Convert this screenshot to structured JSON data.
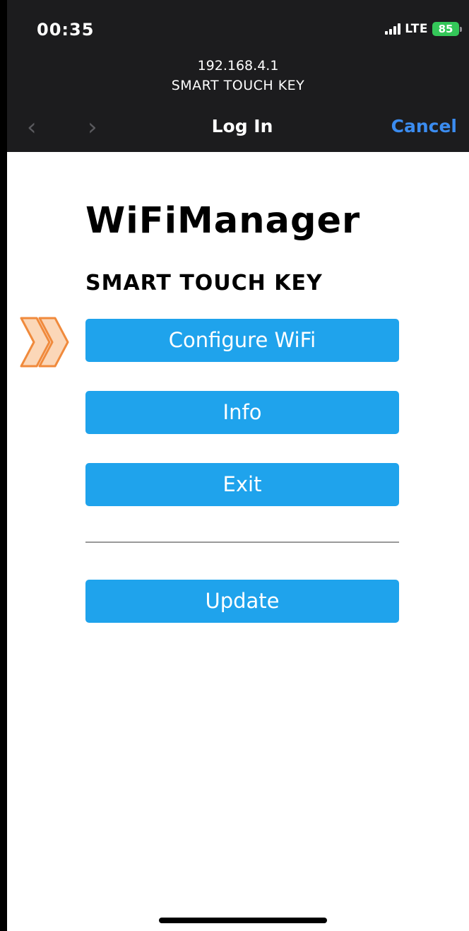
{
  "status_bar": {
    "time": "00:35",
    "network": "LTE",
    "battery": "85"
  },
  "browser": {
    "url": "192.168.4.1",
    "site_name": "SMART TOUCH KEY",
    "nav_title": "Log In",
    "cancel_label": "Cancel",
    "back_glyph": "‹",
    "forward_glyph": "›"
  },
  "page": {
    "title": "WiFiManager",
    "device_name": "SMART TOUCH KEY",
    "buttons": {
      "configure": "Configure WiFi",
      "info": "Info",
      "exit": "Exit",
      "update": "Update"
    }
  },
  "colors": {
    "button": "#1fa3ec",
    "cancel": "#3b8cf0",
    "battery": "#34c759",
    "highlight_arrow": "#f08a3c"
  }
}
